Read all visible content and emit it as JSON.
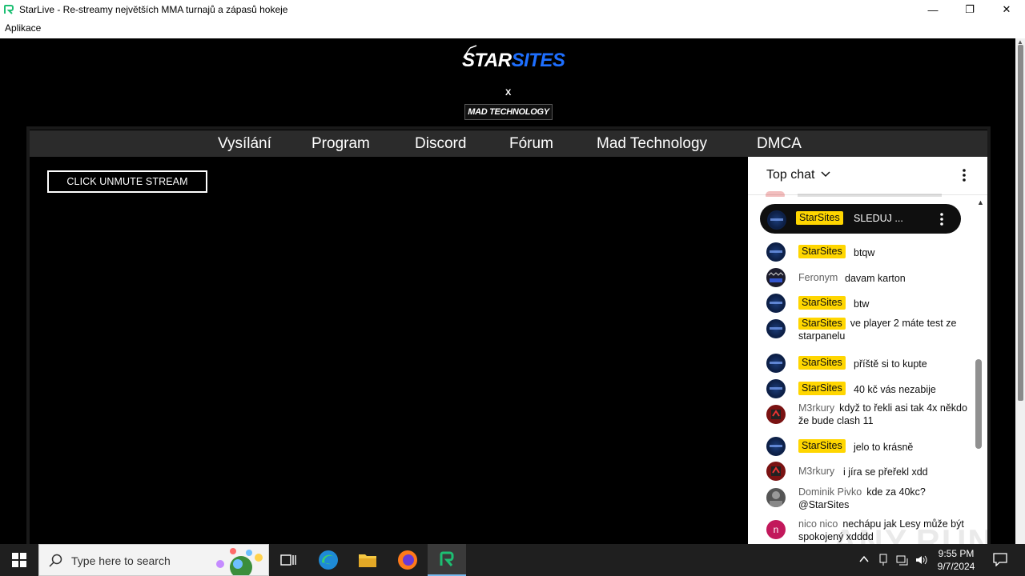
{
  "window": {
    "title": "StarLive - Re-streamy největších MMA turnajů a zápasů hokeje",
    "menu": "Aplikace",
    "controls": {
      "minimize": "—",
      "restore": "❐",
      "close": "✕"
    }
  },
  "logo": {
    "star": "STAR",
    "sites": "SITES",
    "x": "X",
    "partner": "MAD TECHNOLOGY"
  },
  "nav": {
    "items": [
      {
        "label": "Vysílání"
      },
      {
        "label": "Program"
      },
      {
        "label": "Discord"
      },
      {
        "label": "Fórum"
      },
      {
        "label": "Mad Technology"
      },
      {
        "label": "DMCA"
      }
    ]
  },
  "player": {
    "unmute_label": "CLICK UNMUTE STREAM"
  },
  "chat": {
    "title": "Top chat",
    "pinned": {
      "author": "StarSites",
      "text": "SLEDUJ ..."
    },
    "messages": [
      {
        "author": "StarSites",
        "owner": true,
        "text": "btqw"
      },
      {
        "author": "Feronym",
        "owner": false,
        "text": "davam karton"
      },
      {
        "author": "StarSites",
        "owner": true,
        "text": "btw"
      },
      {
        "author": "StarSites",
        "owner": true,
        "text": "ve player 2 máte test ze starpanelu"
      },
      {
        "author": "StarSites",
        "owner": true,
        "text": "příště si to kupte"
      },
      {
        "author": "StarSites",
        "owner": true,
        "text": "40 kč vás nezabije"
      },
      {
        "author": "M3rkury",
        "owner": false,
        "text": "když to řekli asi tak 4x někdo že bude clash 11"
      },
      {
        "author": "StarSites",
        "owner": true,
        "text": "jelo to krásně"
      },
      {
        "author": "M3rkury",
        "owner": false,
        "text": "i jíra se přeřekl xdd"
      },
      {
        "author": "Dominik Pivko",
        "owner": false,
        "text": "kde za 40kc? @StarSites"
      },
      {
        "author": "nico nico",
        "owner": false,
        "text": "nechápu jak Lesy může být spokojený xdddd",
        "initial": "n"
      }
    ]
  },
  "watermark": "ANY.RUN",
  "taskbar": {
    "search_placeholder": "Type here to search",
    "time": "9:55 PM",
    "date": "9/7/2024"
  }
}
